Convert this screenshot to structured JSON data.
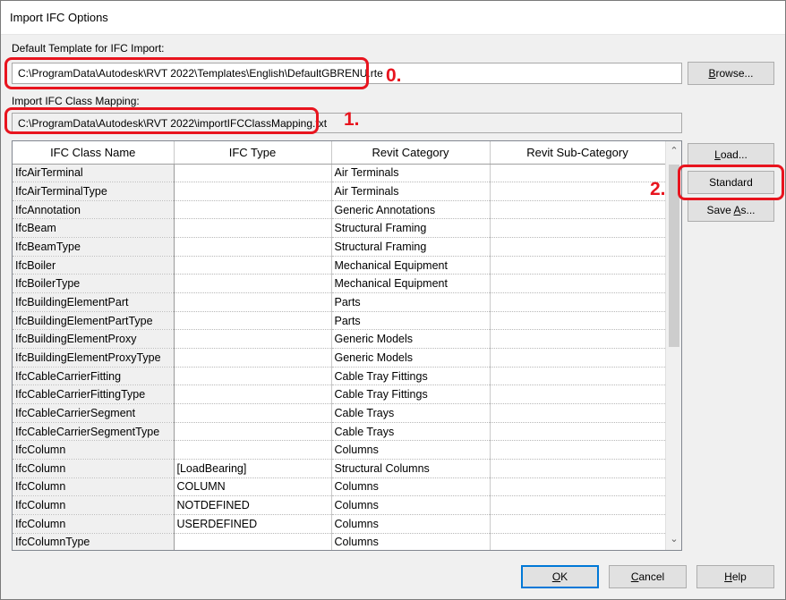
{
  "window": {
    "title": "Import IFC Options"
  },
  "template": {
    "label": "Default Template for IFC Import:",
    "value": "C:\\ProgramData\\Autodesk\\RVT 2022\\Templates\\English\\DefaultGBRENU.rte",
    "browse_label": "Browse..."
  },
  "mapping": {
    "label": "Import IFC Class Mapping:",
    "value": "C:\\ProgramData\\Autodesk\\RVT 2022\\importIFCClassMapping.txt"
  },
  "table": {
    "headers": [
      "IFC Class Name",
      "IFC Type",
      "Revit Category",
      "Revit Sub-Category"
    ],
    "rows": [
      [
        "IfcAirTerminal",
        "",
        "Air Terminals",
        ""
      ],
      [
        "IfcAirTerminalType",
        "",
        "Air Terminals",
        ""
      ],
      [
        "IfcAnnotation",
        "",
        "Generic Annotations",
        ""
      ],
      [
        "IfcBeam",
        "",
        "Structural Framing",
        ""
      ],
      [
        "IfcBeamType",
        "",
        "Structural Framing",
        ""
      ],
      [
        "IfcBoiler",
        "",
        "Mechanical Equipment",
        ""
      ],
      [
        "IfcBoilerType",
        "",
        "Mechanical Equipment",
        ""
      ],
      [
        "IfcBuildingElementPart",
        "",
        "Parts",
        ""
      ],
      [
        "IfcBuildingElementPartType",
        "",
        "Parts",
        ""
      ],
      [
        "IfcBuildingElementProxy",
        "",
        "Generic Models",
        ""
      ],
      [
        "IfcBuildingElementProxyType",
        "",
        "Generic Models",
        ""
      ],
      [
        "IfcCableCarrierFitting",
        "",
        "Cable Tray Fittings",
        ""
      ],
      [
        "IfcCableCarrierFittingType",
        "",
        "Cable Tray Fittings",
        ""
      ],
      [
        "IfcCableCarrierSegment",
        "",
        "Cable Trays",
        ""
      ],
      [
        "IfcCableCarrierSegmentType",
        "",
        "Cable Trays",
        ""
      ],
      [
        "IfcColumn",
        "",
        "Columns",
        ""
      ],
      [
        "IfcColumn",
        "[LoadBearing]",
        "Structural Columns",
        ""
      ],
      [
        "IfcColumn",
        "COLUMN",
        "Columns",
        ""
      ],
      [
        "IfcColumn",
        "NOTDEFINED",
        "Columns",
        ""
      ],
      [
        "IfcColumn",
        "USERDEFINED",
        "Columns",
        ""
      ],
      [
        "IfcColumnType",
        "",
        "Columns",
        ""
      ]
    ]
  },
  "side_buttons": {
    "load": "Load...",
    "standard": "Standard",
    "save_as": "Save As..."
  },
  "footer": {
    "ok": "OK",
    "cancel": "Cancel",
    "help": "Help"
  },
  "annotations": {
    "n0": "0.",
    "n1": "1.",
    "n2": "2."
  },
  "colors": {
    "annotation_red": "#e8141e",
    "default_button_border": "#0078d7"
  }
}
